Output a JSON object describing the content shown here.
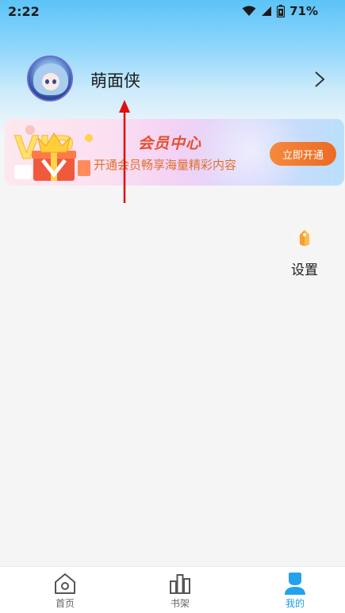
{
  "status_bar": {
    "time": "2:22",
    "battery": "71%",
    "icons": [
      "wifi-icon",
      "signal-icon",
      "battery-icon"
    ]
  },
  "profile": {
    "username": "萌面侠"
  },
  "vip_banner": {
    "title": "会员中心",
    "subtitle": "开通会员畅享海量精彩内容",
    "button_label": "立即开通",
    "accent_color": "#ec6a24"
  },
  "settings": {
    "label": "设置",
    "icon": "settings-tag-icon"
  },
  "bottom_nav": {
    "items": [
      {
        "label": "首页",
        "icon": "home-icon",
        "active": false
      },
      {
        "label": "书架",
        "icon": "bookshelf-icon",
        "active": false
      },
      {
        "label": "我的",
        "icon": "person-icon",
        "active": true
      }
    ],
    "active_color": "#1b9ae6"
  }
}
